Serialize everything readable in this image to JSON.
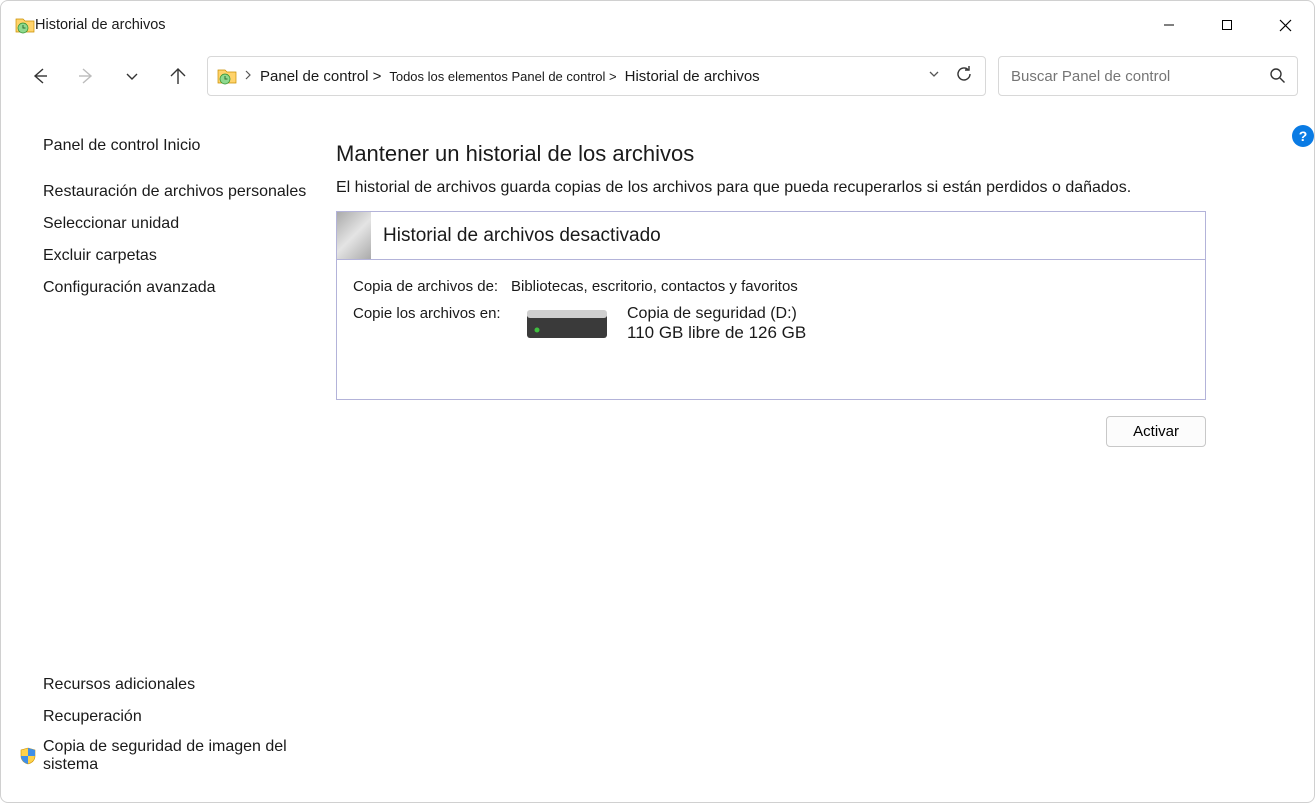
{
  "window": {
    "title": "Historial de archivos"
  },
  "breadcrumb": {
    "seg1": "Panel de control >",
    "seg2": "Todos los elementos Panel de control >",
    "seg3": "Historial de archivos"
  },
  "search": {
    "placeholder": "Buscar Panel de control"
  },
  "sidebar": {
    "home": "Panel de control Inicio",
    "links": [
      "Restauración de archivos personales",
      "Seleccionar unidad",
      "Excluir carpetas",
      "Configuración avanzada"
    ],
    "footer_heading": "Recursos adicionales",
    "footer_links": [
      "Recuperación",
      "Copia de seguridad de imagen del sistema"
    ]
  },
  "main": {
    "heading": "Mantener un historial de los archivos",
    "subtitle": "El historial de archivos guarda copias de los archivos para que pueda recuperarlos si están perdidos o dañados.",
    "status_title": "Historial de archivos desactivado",
    "copy_from_label": "Copia de archivos de:",
    "copy_from_value": "Bibliotecas, escritorio, contactos y favoritos",
    "copy_to_label": "Copie los archivos en:",
    "drive_name": "Copia de seguridad (D:)",
    "drive_free": "110 GB",
    "drive_mid": " libre de ",
    "drive_total": "126 GB",
    "activate_label": "Activar"
  }
}
